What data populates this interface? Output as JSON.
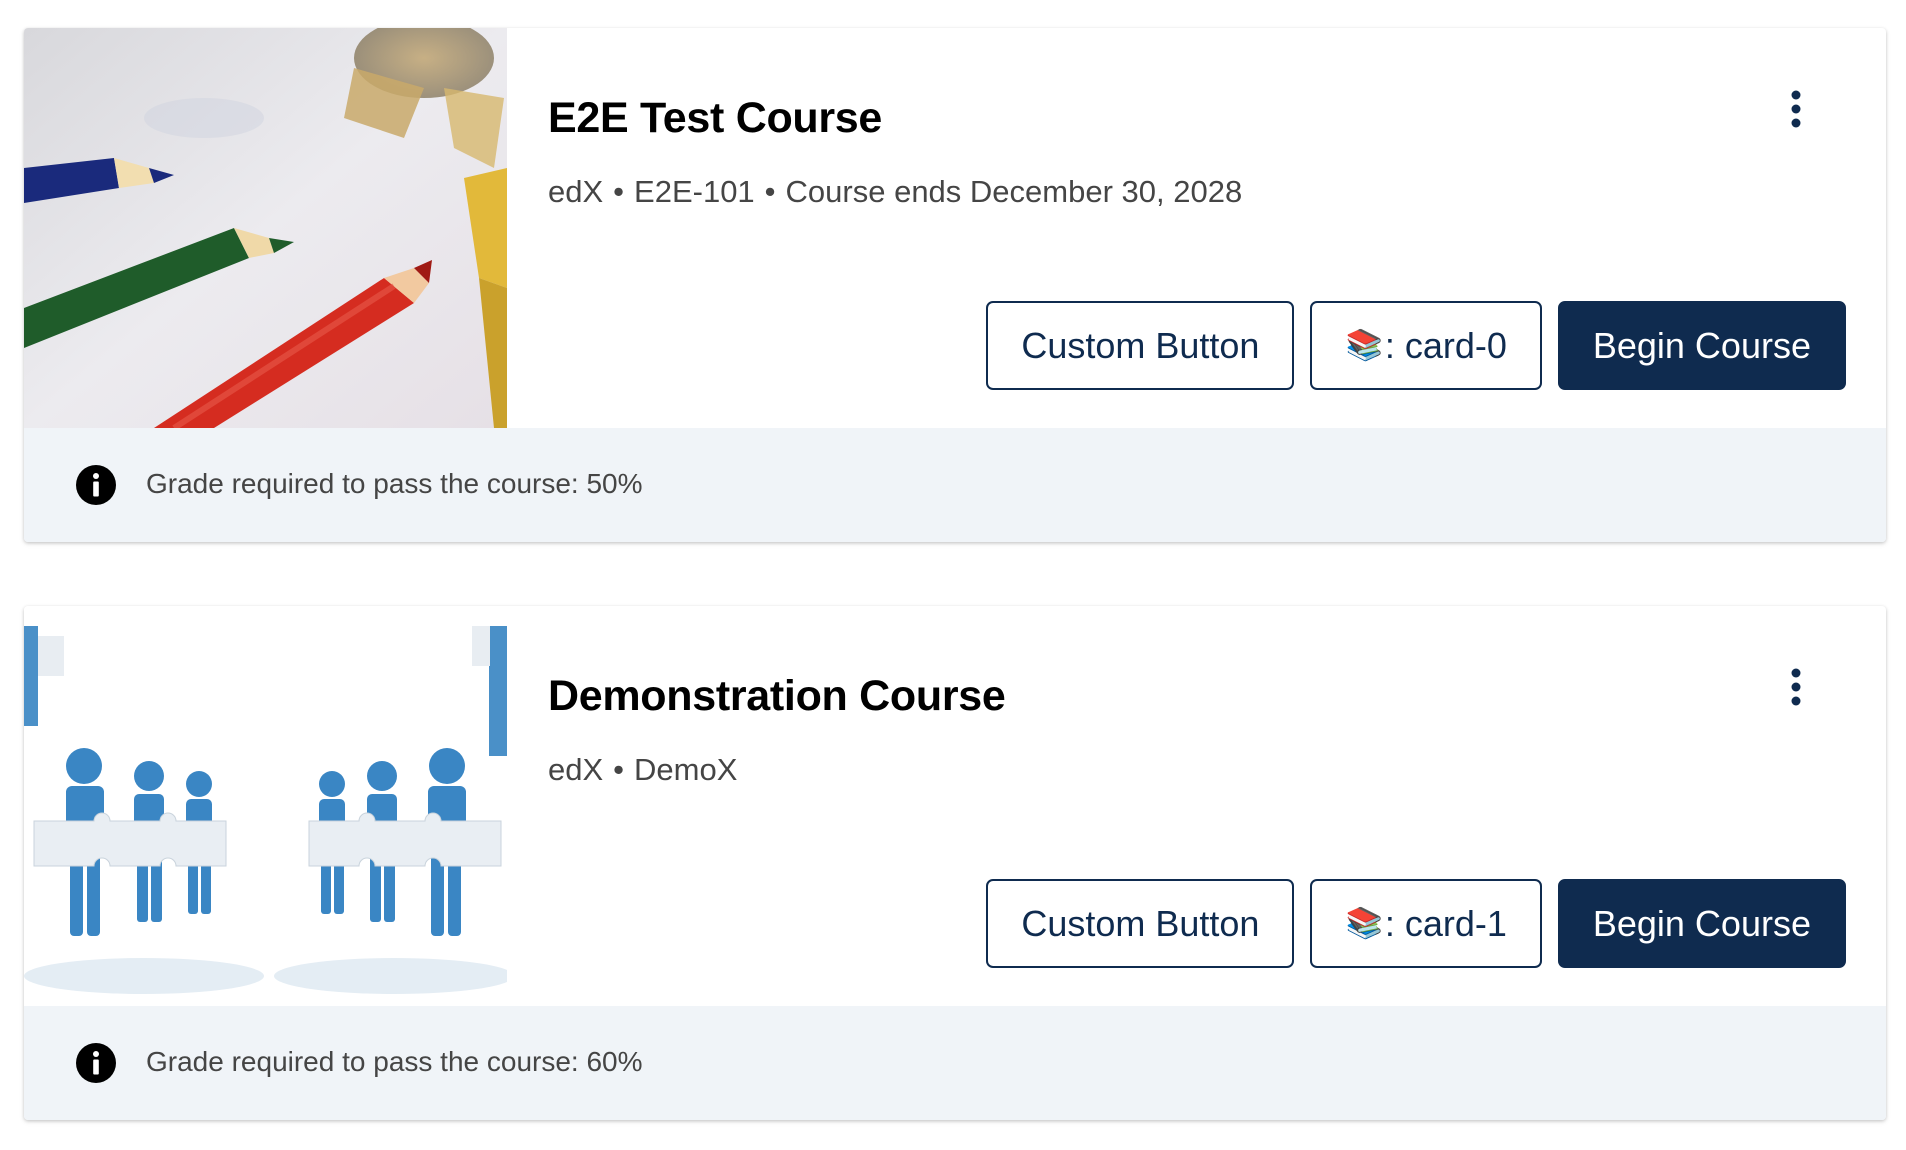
{
  "cards": [
    {
      "title": "E2E Test Course",
      "org": "edX",
      "course_number": "E2E-101",
      "end_text": "Course ends December 30, 2028",
      "custom_button_label": "Custom Button",
      "emoji": "📚",
      "emoji_button_text": ": card-0",
      "begin_button_label": "Begin Course",
      "grade_text": "Grade required to pass the course: 50%"
    },
    {
      "title": "Demonstration Course",
      "org": "edX",
      "course_number": "DemoX",
      "custom_button_label": "Custom Button",
      "emoji": "📚",
      "emoji_button_text": ": card-1",
      "begin_button_label": "Begin Course",
      "grade_text": "Grade required to pass the course: 60%"
    }
  ],
  "separator": "•",
  "icons": {
    "menu": "more-vertical-icon",
    "info": "info-icon",
    "image_0": "pencils-thumbnail",
    "image_1": "puzzle-people-thumbnail"
  },
  "colors": {
    "brand_dark": "#0f2b4f",
    "footer_bg": "#f0f4f8",
    "meta_text": "#454545"
  }
}
